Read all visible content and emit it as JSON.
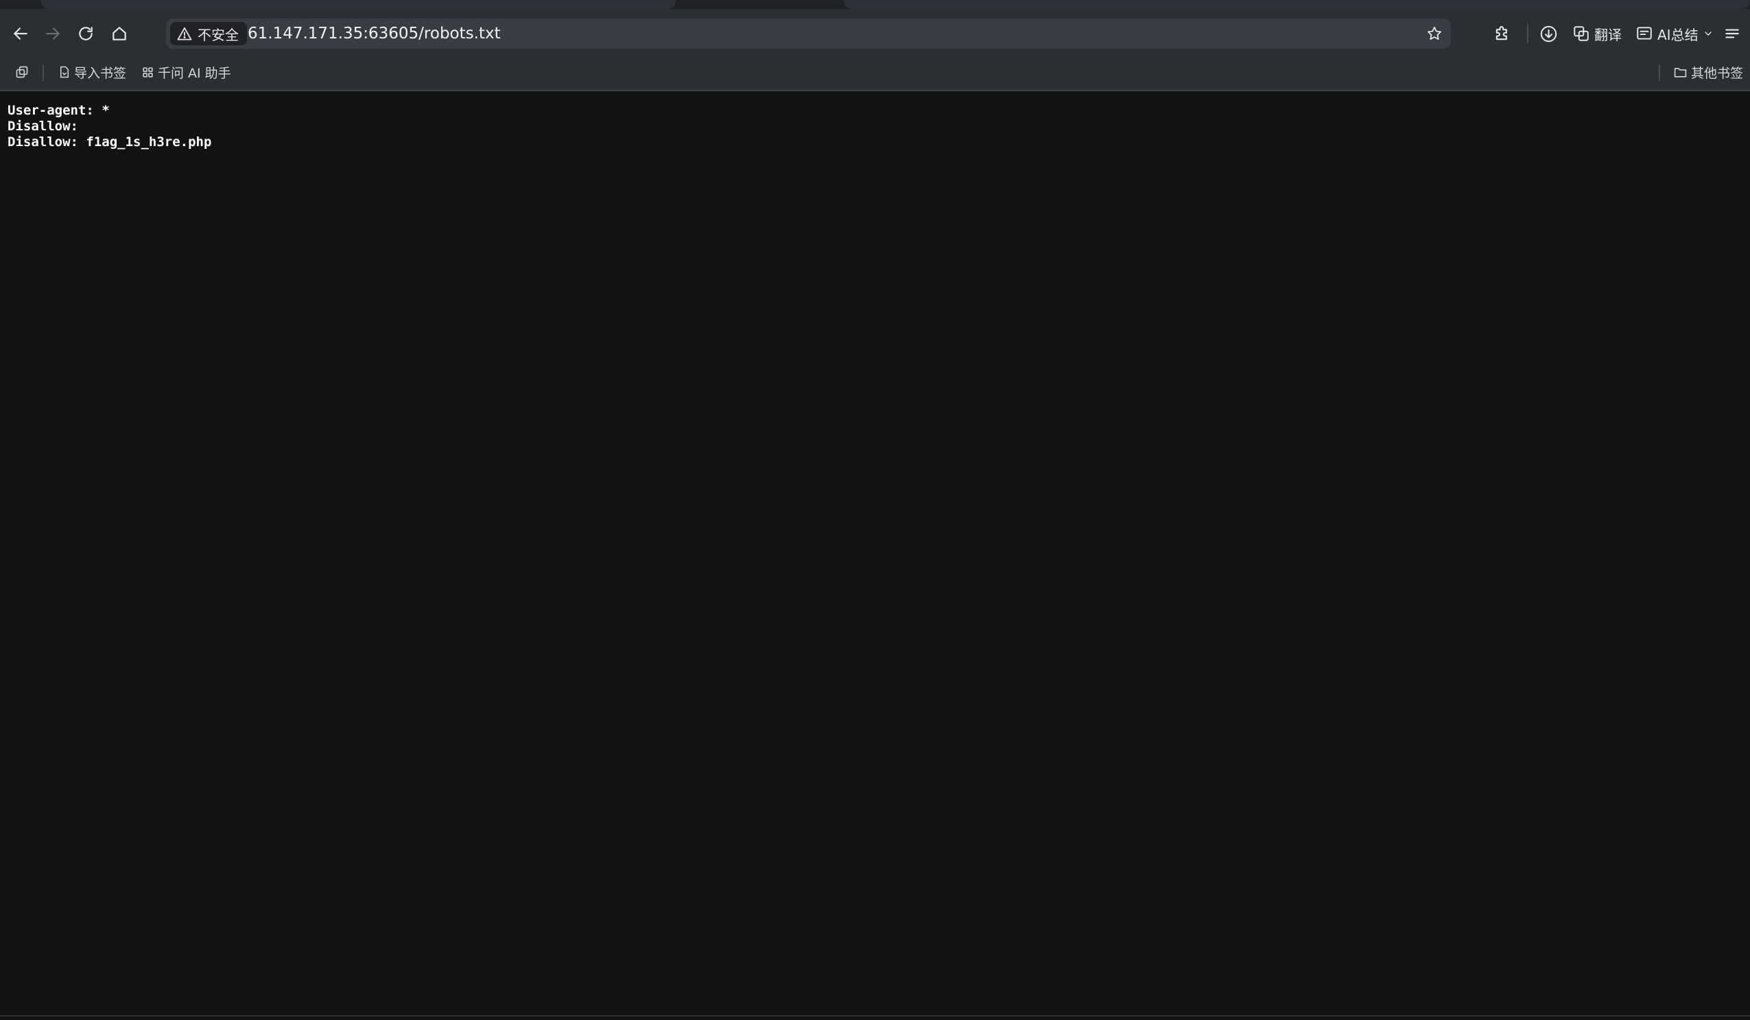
{
  "address_bar": {
    "security_label": "不安全",
    "url": "61.147.171.35:63605/robots.txt"
  },
  "toolbar": {
    "translate_label": "翻译",
    "ai_summary_label": "AI总结"
  },
  "bookmarks": {
    "items": [
      {
        "label": "导入书签",
        "icon": "file-import-icon"
      },
      {
        "label": "千问 AI 助手",
        "icon": "grid-icon"
      }
    ],
    "other_label": "其他书签"
  },
  "page": {
    "lines": [
      "User-agent: *",
      "Disallow:",
      "Disallow: f1ag_1s_h3re.php"
    ]
  },
  "colors": {
    "background": "#121212",
    "toolbar": "#2b2e33",
    "omnibox": "#393c42",
    "text": "#ffffff"
  }
}
